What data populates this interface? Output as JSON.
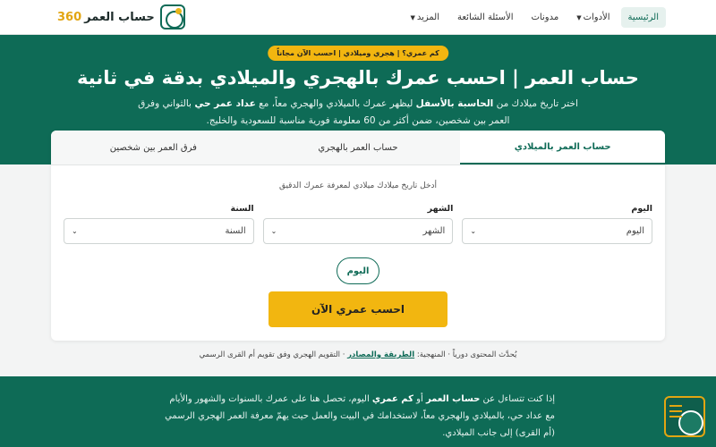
{
  "brand": {
    "name": "حساب العمر",
    "number": "360"
  },
  "nav": {
    "home": "الرئيسية",
    "tools": "الأدوات",
    "blogs": "مدونات",
    "faq": "الأسئلة الشائعة",
    "more": "المزيد"
  },
  "hero": {
    "badge": "كم عمري؟ | هجري وميلادي | احسب الآن مجاناً",
    "title": "حساب العمر | احسب عمرك بالهجري والميلادي بدقة في ثانية",
    "desc_1": "اختر تاريخ ميلادك من ",
    "desc_bold_1": "الحاسبة بالأسفل",
    "desc_2": " ليظهر عمرك بالميلادي والهجري معاً، مع ",
    "desc_bold_2": "عداد عمر حي",
    "desc_3": " بالثواني وفرق العمر بين شخصين، ضمن أكثر من 60 معلومة فورية مناسبة للسعودية والخليج."
  },
  "tabs": [
    {
      "label": "حساب العمر بالميلادي",
      "active": true
    },
    {
      "label": "حساب العمر بالهجري",
      "active": false
    },
    {
      "label": "فرق العمر بين شخصين",
      "active": false
    }
  ],
  "calculator": {
    "hint": "أدخل تاريخ ميلادك ميلادي لمعرفة عمرك الدقيق",
    "day": {
      "label": "اليوم",
      "value": "اليوم"
    },
    "month": {
      "label": "الشهر",
      "value": "الشهر"
    },
    "year": {
      "label": "السنة",
      "value": "السنة"
    },
    "today_label": "اليوم",
    "submit_label": "احسب عمري الآن"
  },
  "meta": {
    "text_1": "يُحدَّث المحتوى دورياً · المنهجية: ",
    "link": "الطريقة والمصادر",
    "text_2": " · التقويم الهجري وفق تقويم أم القرى الرسمي"
  },
  "bottom": {
    "t1": "إذا كنت تتساءل عن ",
    "b1": "حساب العمر",
    "t2": " أو ",
    "b2": "كم عمري",
    "t3": " اليوم، تحصل هنا على عمرك بالسنوات والشهور والأيام مع عداد حي، بالميلادي والهجري معاً، لاستخدامك في البيت والعمل حيث يهمّ معرفة العمر الهجري الرسمي (أم القرى) إلى جانب الميلادي."
  },
  "colors": {
    "primary": "#0e6b56",
    "accent": "#f2b610"
  }
}
